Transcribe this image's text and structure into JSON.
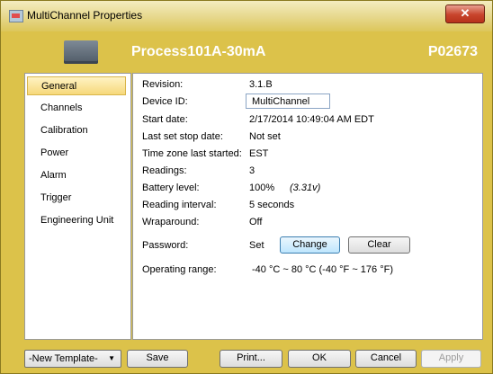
{
  "window": {
    "title": "MultiChannel Properties",
    "close_glyph": "✕"
  },
  "header": {
    "device_name": "Process101A-30mA",
    "serial": "P02673",
    "device_icon": "device-icon"
  },
  "sidebar": {
    "items": [
      {
        "label": "General",
        "active": true
      },
      {
        "label": "Channels"
      },
      {
        "label": "Calibration"
      },
      {
        "label": "Power"
      },
      {
        "label": "Alarm"
      },
      {
        "label": "Trigger"
      },
      {
        "label": "Engineering Unit"
      }
    ]
  },
  "general": {
    "revision_label": "Revision:",
    "revision": "3.1.B",
    "device_id_label": "Device ID:",
    "device_id": "MultiChannel",
    "start_date_label": "Start date:",
    "start_date": "2/17/2014 10:49:04 AM EDT",
    "stop_date_label": "Last set stop date:",
    "stop_date": "Not set",
    "timezone_label": "Time zone last started:",
    "timezone": "EST",
    "readings_label": "Readings:",
    "readings": "3",
    "battery_label": "Battery level:",
    "battery": "100%",
    "battery_voltage": "(3.31v)",
    "interval_label": "Reading interval:",
    "interval": "5 seconds",
    "wrap_label": "Wraparound:",
    "wrap": "Off",
    "password_label": "Password:",
    "password": "Set",
    "change_label": "Change",
    "clear_label": "Clear",
    "range_label": "Operating range:",
    "range": "-40 °C ~ 80 °C (-40 °F ~ 176 °F)"
  },
  "footer": {
    "template": "-New Template-",
    "template_arrow": "▼",
    "save": "Save",
    "print": "Print...",
    "ok": "OK",
    "cancel": "Cancel",
    "apply": "Apply"
  }
}
